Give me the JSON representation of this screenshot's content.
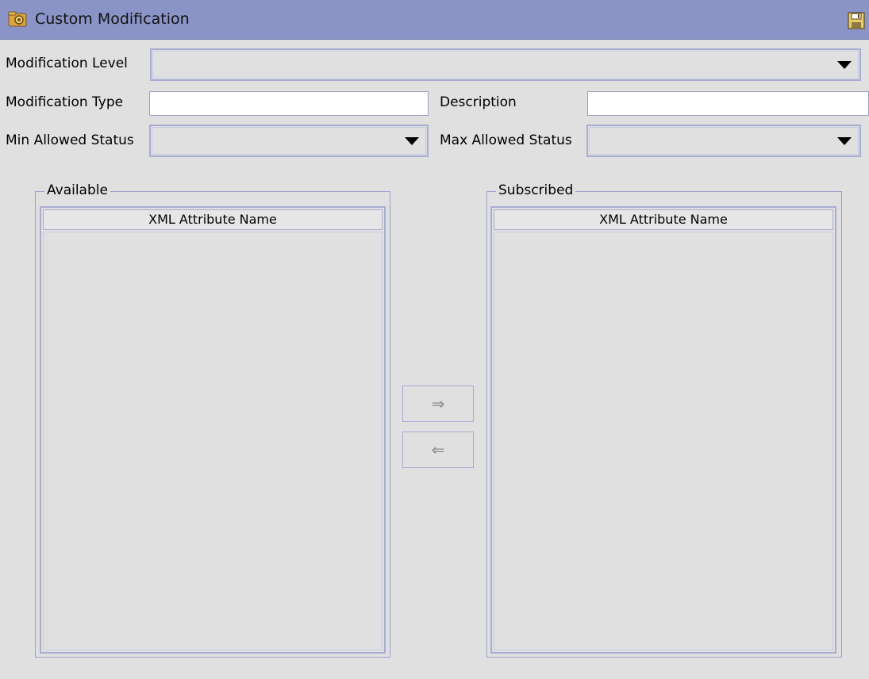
{
  "window": {
    "title": "Custom Modification",
    "title_icon": "gear-folder-icon",
    "save_icon": "save-icon"
  },
  "form": {
    "modification_level": {
      "label": "Modification Level",
      "value": ""
    },
    "modification_type": {
      "label": "Modification Type",
      "value": ""
    },
    "description": {
      "label": "Description",
      "value": ""
    },
    "min_allowed_status": {
      "label": "Min Allowed Status",
      "value": ""
    },
    "max_allowed_status": {
      "label": "Max Allowed Status",
      "value": ""
    }
  },
  "available": {
    "title": "Available",
    "column_header": "XML Attribute Name",
    "rows": []
  },
  "subscribed": {
    "title": "Subscribed",
    "column_header": "XML Attribute Name",
    "rows": []
  },
  "buttons": {
    "move_right": "⇒",
    "move_left": "⇐"
  },
  "colors": {
    "titlebar": "#8b94c7",
    "background": "#e0e0e0",
    "border": "#a8acd3"
  }
}
